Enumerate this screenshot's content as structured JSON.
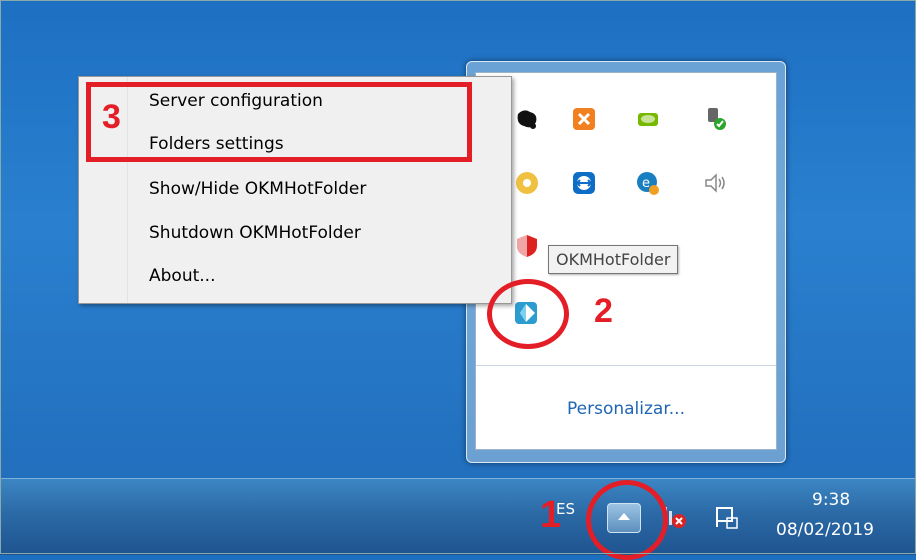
{
  "context_menu": {
    "items": [
      {
        "label": "Server configuration"
      },
      {
        "label": "Folders settings"
      },
      {
        "label": "Show/Hide OKMHotFolder"
      },
      {
        "label": "Shutdown OKMHotFolder"
      },
      {
        "label": "About..."
      }
    ]
  },
  "tray": {
    "tooltip": "OKMHotFolder",
    "customize_link": "Personalizar...",
    "icons": [
      "ink-blot-icon",
      "xampp-icon",
      "nvidia-icon",
      "power-plug-icon",
      "cd-icon",
      "teamviewer-icon",
      "dropbox-icon",
      "speaker-icon",
      "shield-icon",
      "okmhotfolder-icon"
    ]
  },
  "taskbar": {
    "language": "ES",
    "time": "9:38",
    "date": "08/02/2019"
  },
  "annotations": {
    "step1": "1",
    "step2": "2",
    "step3": "3"
  },
  "colors": {
    "annotation": "#e41e26",
    "link": "#1f65b5"
  }
}
